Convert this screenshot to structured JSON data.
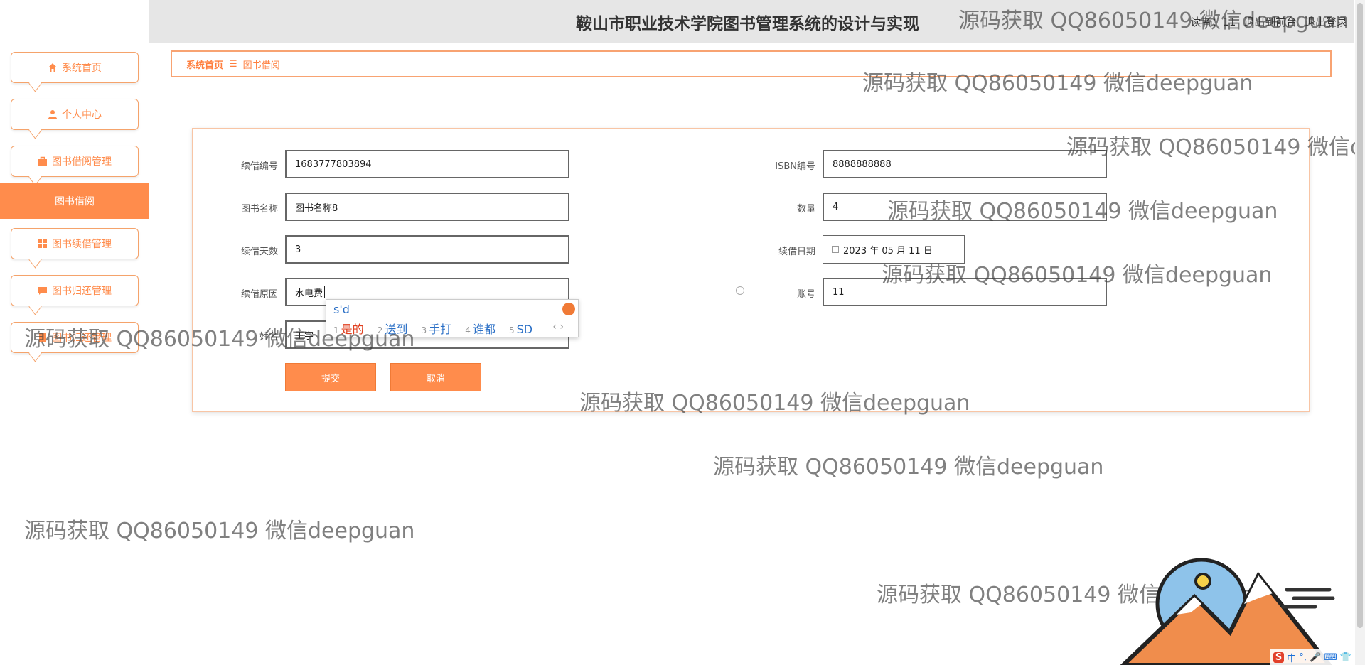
{
  "header": {
    "title": "鞍山市职业技术学院图书管理系统的设计与实现",
    "user_text": "读者：11",
    "exit_front": "退出到前台",
    "logout": "退出登录"
  },
  "sidebar": {
    "items": [
      {
        "label": "系统首页",
        "icon": "home-icon"
      },
      {
        "label": "个人中心",
        "icon": "user-icon"
      },
      {
        "label": "图书借阅管理",
        "icon": "briefcase-icon"
      },
      {
        "label": "图书续借管理",
        "icon": "grid-icon"
      },
      {
        "label": "图书归还管理",
        "icon": "chat-icon"
      },
      {
        "label": "图书归还管理",
        "icon": "book-icon"
      }
    ],
    "active_submenu": "图书借阅"
  },
  "breadcrumb": {
    "home": "系统首页",
    "separator": "☰",
    "current": "图书借阅"
  },
  "form": {
    "fields": {
      "renew_no": {
        "label": "续借编号",
        "value": "1683777803894"
      },
      "isbn": {
        "label": "ISBN编号",
        "value": "8888888888"
      },
      "book_name": {
        "label": "图书名称",
        "value": "图书名称8"
      },
      "quantity": {
        "label": "数量",
        "value": "4"
      },
      "renew_days": {
        "label": "续借天数",
        "value": "3"
      },
      "renew_date": {
        "label": "续借日期",
        "value": "2023 年 05 月 11 日"
      },
      "reason": {
        "label": "续借原因",
        "value": "水电费"
      },
      "account": {
        "label": "账号",
        "value": "11"
      },
      "name": {
        "label": "姓名",
        "value": "王宇"
      }
    },
    "submit_label": "提交",
    "cancel_label": "取消"
  },
  "ime": {
    "input": "s'd",
    "candidates": [
      {
        "n": "1",
        "text": "是的"
      },
      {
        "n": "2",
        "text": "送到"
      },
      {
        "n": "3",
        "text": "手打"
      },
      {
        "n": "4",
        "text": "谁都"
      },
      {
        "n": "5",
        "text": "SD"
      }
    ],
    "arrows": "‹ ›"
  },
  "watermark": "源码获取 QQ86050149 微信deepguan",
  "taskbar": {
    "ime_logo": "S",
    "lang": "中",
    "items": [
      "°,",
      "🎤",
      "⌨",
      "👕",
      "⊞"
    ]
  },
  "colors": {
    "accent": "#ff8c4c",
    "border": "#f8a372",
    "header_bg": "#e6e6e6"
  }
}
